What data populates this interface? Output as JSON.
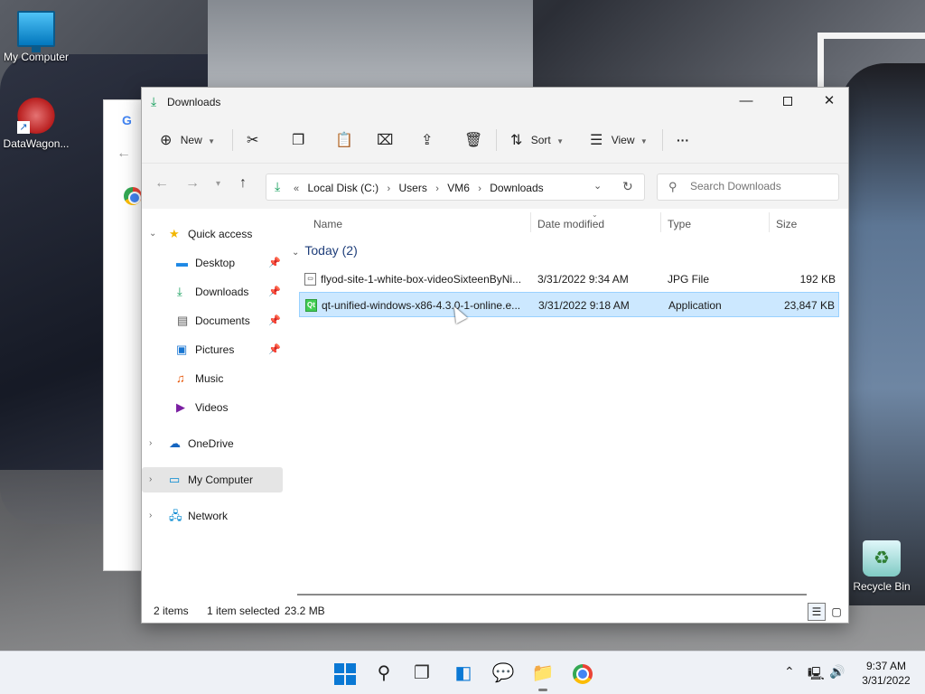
{
  "desktop": {
    "icons": [
      {
        "label": "My Computer"
      },
      {
        "label": "DataWagon..."
      },
      {
        "label": "Recycle Bin"
      }
    ]
  },
  "window": {
    "title": "Downloads",
    "controls": {
      "minimize": "—",
      "maximize": "",
      "close": "✕"
    }
  },
  "commandbar": {
    "new_label": "New",
    "sort_label": "Sort",
    "view_label": "View",
    "more_label": "···"
  },
  "address": {
    "prefix": "«",
    "crumbs": [
      "Local Disk (C:)",
      "Users",
      "VM6",
      "Downloads"
    ],
    "separator": "›"
  },
  "search": {
    "placeholder": "Search Downloads"
  },
  "navpane": {
    "quick_access": "Quick access",
    "items": [
      {
        "label": "Desktop",
        "icon": "desktop-icon",
        "pinned": true
      },
      {
        "label": "Downloads",
        "icon": "download-icon",
        "pinned": true
      },
      {
        "label": "Documents",
        "icon": "documents-icon",
        "pinned": true
      },
      {
        "label": "Pictures",
        "icon": "pictures-icon",
        "pinned": true
      },
      {
        "label": "Music",
        "icon": "music-icon",
        "pinned": false
      },
      {
        "label": "Videos",
        "icon": "videos-icon",
        "pinned": false
      }
    ],
    "onedrive": "OneDrive",
    "my_computer": "My Computer",
    "network": "Network"
  },
  "columns": {
    "name": "Name",
    "date": "Date modified",
    "type": "Type",
    "size": "Size"
  },
  "group": {
    "label": "Today (2)"
  },
  "files": [
    {
      "name": "flyod-site-1-white-box-videoSixteenByNi...",
      "date": "3/31/2022 9:34 AM",
      "type": "JPG File",
      "size": "192 KB",
      "icon": "image-file-icon",
      "selected": false
    },
    {
      "name": "qt-unified-windows-x86-4.3.0-1-online.e...",
      "date": "3/31/2022 9:18 AM",
      "type": "Application",
      "size": "23,847 KB",
      "icon": "qt-app-icon",
      "selected": true
    }
  ],
  "status": {
    "items": "2 items",
    "selected": "1 item selected",
    "size": "23.2 MB"
  },
  "taskbar": {
    "time": "9:37 AM",
    "date": "3/31/2022"
  },
  "colors": {
    "accent": "#0a78d4",
    "selection": "#cce8ff",
    "download_green": "#0f9d58"
  }
}
